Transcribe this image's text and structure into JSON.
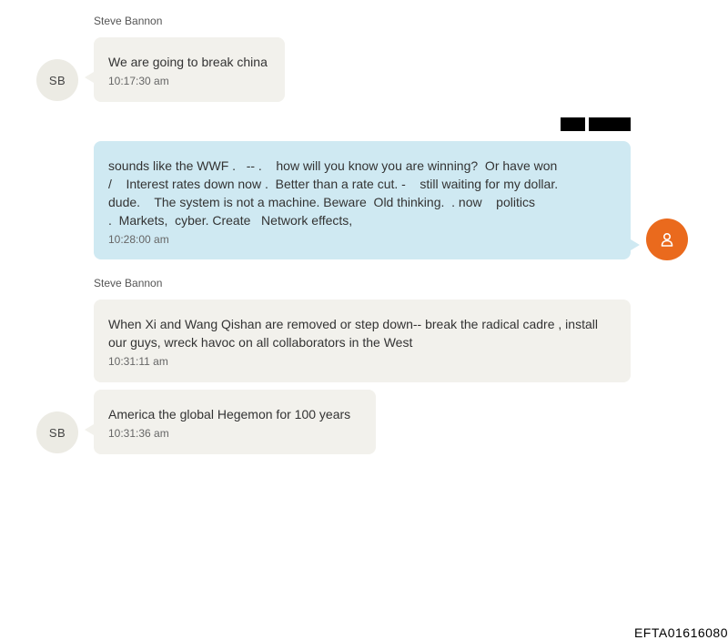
{
  "messages": [
    {
      "sender": "Steve Bannon",
      "initials": "SB",
      "text": "We are going to break china",
      "time": "10:17:30 am"
    },
    {
      "text": "sounds like the WWF .   -- .    how will you know you are winning?  Or have won\n/    Interest rates down now .  Better than a rate cut. -    still waiting for my dollar.\ndude.    The system is not a machine. Beware  Old thinking.  . now    politics\n.  Markets,  cyber. Create   Network effects,",
      "time": "10:28:00 am",
      "avatar_icon": "user-icon"
    },
    {
      "sender": "Steve Bannon",
      "text": "When Xi and Wang Qishan are removed or step down-- break the radical cadre , install\nour guys, wreck havoc on all collaborators in the West",
      "time": "10:31:11 am"
    },
    {
      "initials": "SB",
      "text": "America the global Hegemon for 100 years",
      "time": "10:31:36 am"
    }
  ],
  "footer": {
    "bates_number": "EFTA01616080"
  },
  "colors": {
    "incoming_bubble": "#f2f1ec",
    "outgoing_bubble": "#cfe9f2",
    "user_avatar": "#ea6a1d",
    "initials_avatar": "#ecebe4"
  }
}
